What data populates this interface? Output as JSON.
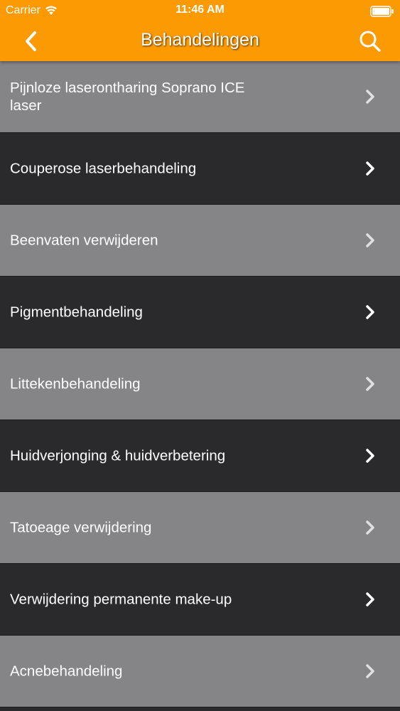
{
  "status_bar": {
    "carrier": "Carrier",
    "time": "11:46 AM"
  },
  "nav": {
    "title": "Behandelingen",
    "back_icon": "chevron-left-icon",
    "search_icon": "search-icon"
  },
  "colors": {
    "accent": "#fc9a04",
    "row_light": "#858486",
    "row_dark": "#2a292b"
  },
  "treatments": [
    {
      "label": "Pijnloze laserontharing Soprano ICE laser"
    },
    {
      "label": "Couperose laserbehandeling"
    },
    {
      "label": "Beenvaten verwijderen"
    },
    {
      "label": "Pigmentbehandeling"
    },
    {
      "label": "Littekenbehandeling"
    },
    {
      "label": "Huidverjonging & huidverbetering"
    },
    {
      "label": "Tatoeage verwijdering"
    },
    {
      "label": "Verwijdering permanente make-up"
    },
    {
      "label": "Acnebehandeling"
    }
  ]
}
